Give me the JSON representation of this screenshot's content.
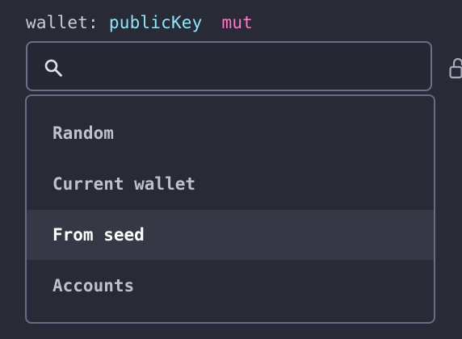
{
  "field": {
    "name": "wallet:",
    "type": "publicKey",
    "modifier": "mut"
  },
  "search": {
    "value": "",
    "placeholder": "",
    "icon": "search-icon"
  },
  "dropdown": {
    "options": [
      {
        "label": "Random"
      },
      {
        "label": "Current wallet"
      },
      {
        "label": "From seed",
        "highlighted": true
      },
      {
        "label": "Accounts"
      }
    ]
  },
  "colors": {
    "background": "#282a36",
    "type": "#8be9fd",
    "modifier": "#ff79c6",
    "border": "#6f6e8a",
    "highlight": "#363845"
  }
}
